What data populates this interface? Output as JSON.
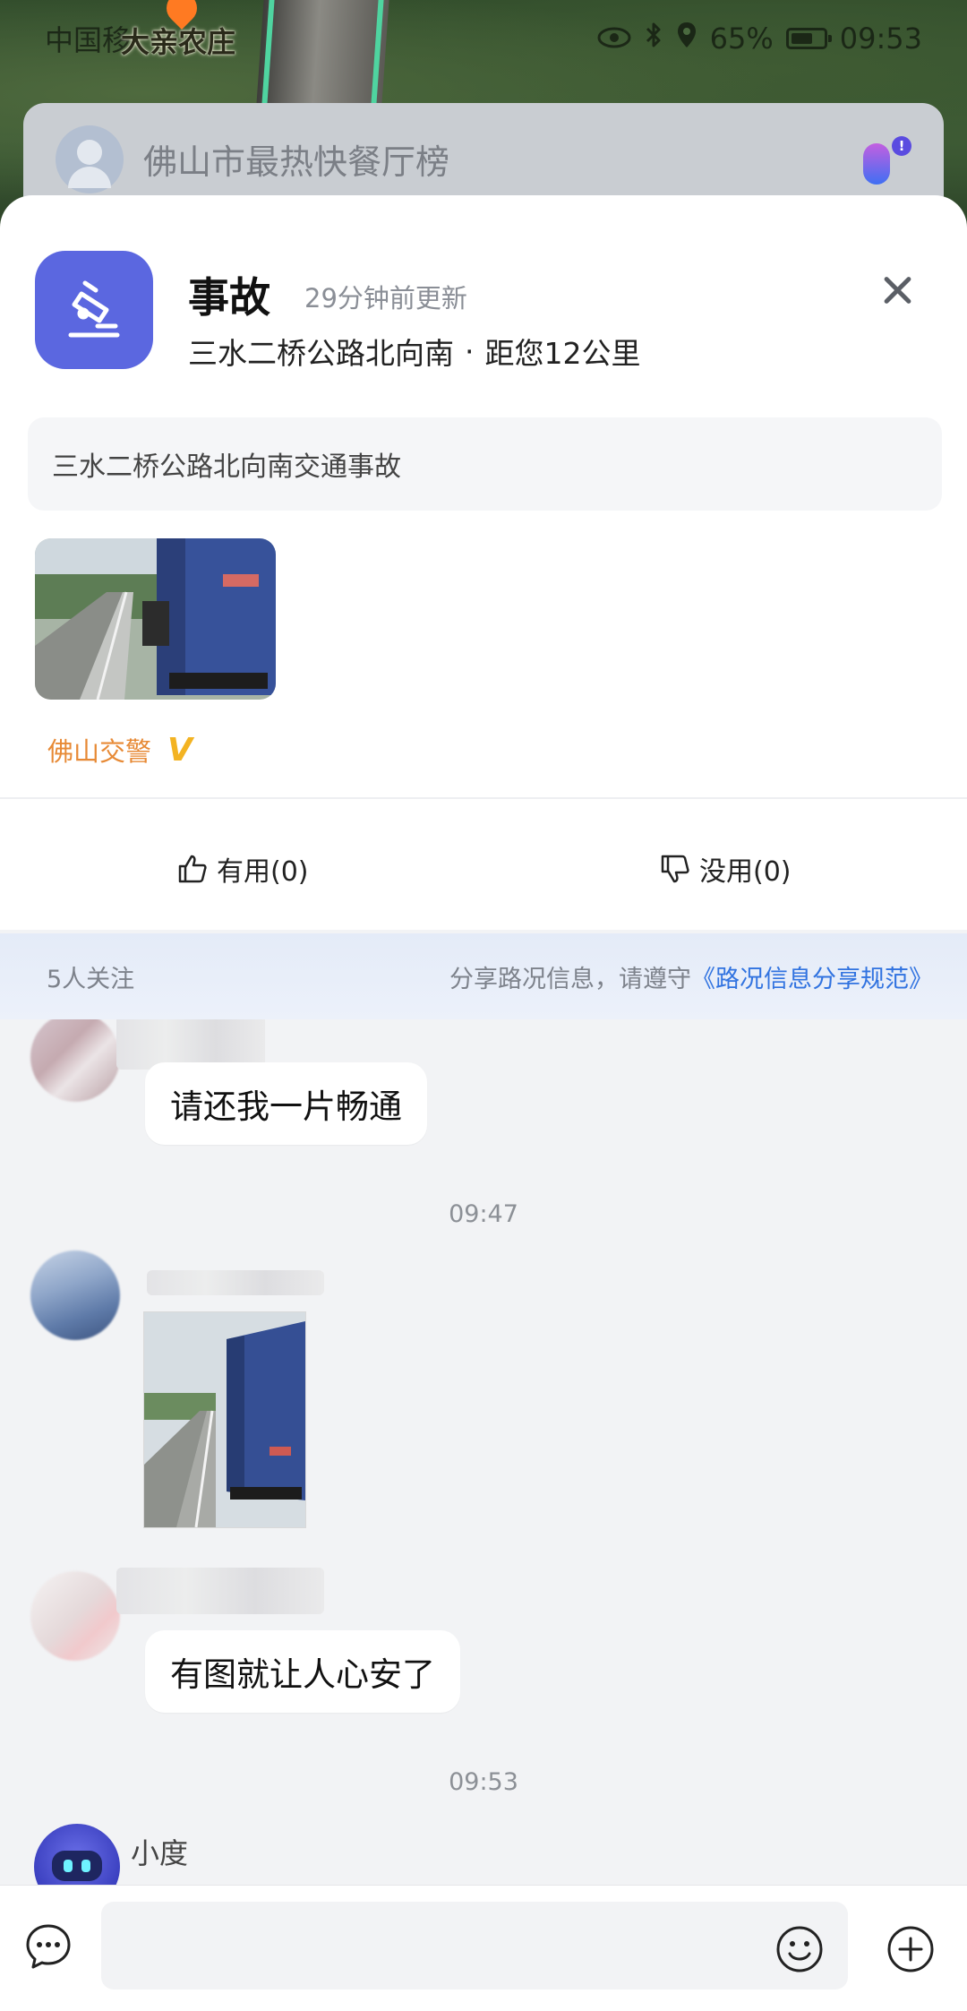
{
  "status_bar": {
    "carrier": "中国移",
    "map_place_label": "大亲农庄",
    "battery": "65%",
    "time": "09:53"
  },
  "search": {
    "placeholder": "佛山市最热快餐厅榜",
    "mic_badge": "!"
  },
  "event": {
    "title": "事故",
    "updated": "29分钟前更新",
    "road": "三水二桥公路北向南",
    "separator": "·",
    "distance": "距您12公里",
    "description": "三水二桥公路北向南交通事故",
    "source": "佛山交警",
    "source_badge": "V"
  },
  "votes": {
    "useful": "有用(0)",
    "useless": "没用(0)"
  },
  "rules_banner": {
    "followers": "5人关注",
    "notice": "分享路况信息，请遵守",
    "link": "《路况信息分享规范》"
  },
  "chat": {
    "messages": [
      {
        "type": "text",
        "text": "请还我一片畅通"
      },
      {
        "type": "time",
        "text": "09:47"
      },
      {
        "type": "image"
      },
      {
        "type": "text",
        "text": "有图就让人心安了"
      },
      {
        "type": "time",
        "text": "09:53"
      }
    ],
    "bot_name": "小度"
  },
  "icons": {
    "event": "accident-icon",
    "close": "close-icon",
    "useful": "thumbs-up-icon",
    "useless": "thumbs-down-icon",
    "more": "chat-bubble-more-icon",
    "emoji": "emoji-icon",
    "add": "plus-circle-icon"
  },
  "colors": {
    "event_icon_bg": "#5b67e0",
    "source_text": "#e78a36",
    "link": "#3173e0"
  }
}
